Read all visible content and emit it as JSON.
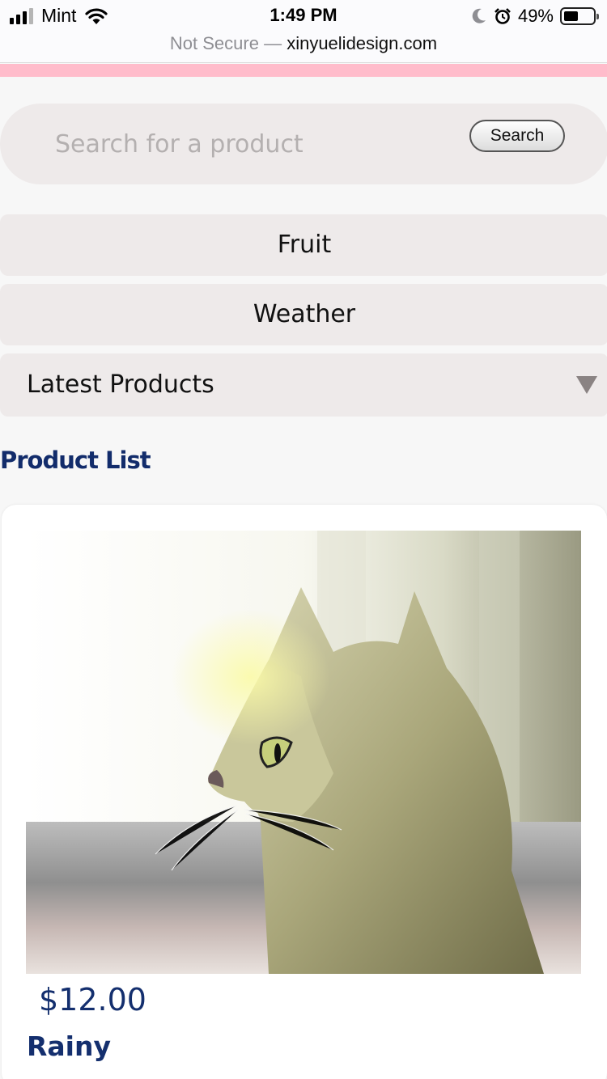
{
  "status_bar": {
    "carrier": "Mint",
    "time": "1:49 PM",
    "battery_percent": "49%",
    "battery_level": 0.49,
    "icons": [
      "signal-icon",
      "wifi-icon",
      "moon-icon",
      "alarm-icon",
      "battery-icon"
    ]
  },
  "browser": {
    "security": "Not Secure —",
    "domain": "xinyuelidesign.com"
  },
  "colors": {
    "accent_pink": "#ffbccb",
    "brand_navy": "#142f6e",
    "panel_gray": "#eeeaea"
  },
  "search": {
    "placeholder": "Search for a product",
    "value": "",
    "button_label": "Search"
  },
  "categories": [
    {
      "label": "Fruit"
    },
    {
      "label": "Weather"
    }
  ],
  "latest_products": {
    "label": "Latest Products",
    "icon": "caret-down-icon"
  },
  "product_list": {
    "title": "Product List",
    "items": [
      {
        "price": "$12.00",
        "name": "Rainy",
        "image": "cat-by-window-painting"
      }
    ]
  }
}
